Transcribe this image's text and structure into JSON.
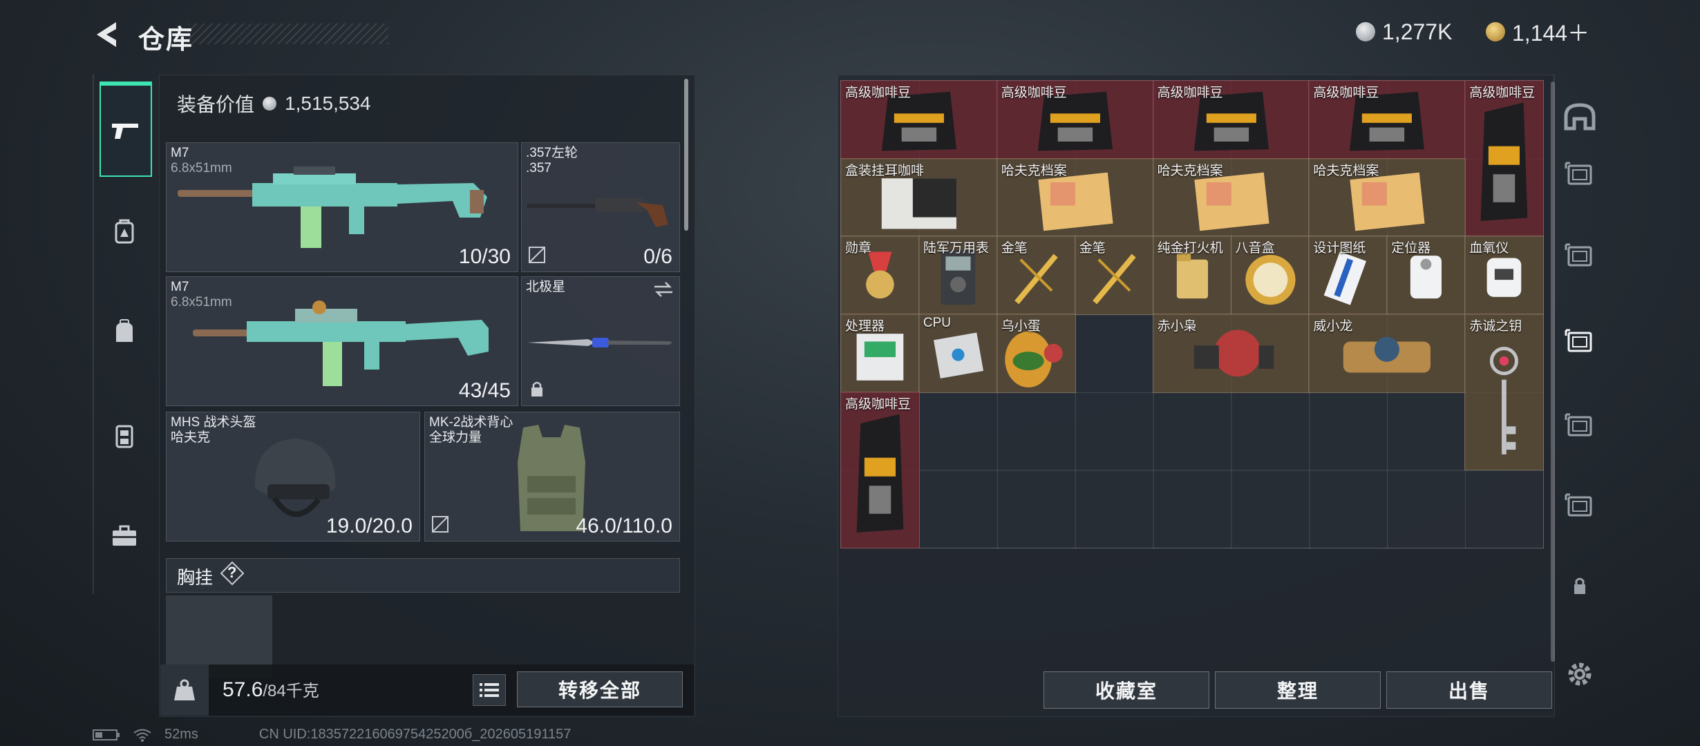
{
  "header": {
    "title": "仓库",
    "currency": [
      {
        "value": "1,277K",
        "icon": "silver-coin-icon",
        "color": "#c9ccd1"
      },
      {
        "value": "1,144＋",
        "icon": "gold-coin-icon",
        "color": "#d9b25a"
      }
    ]
  },
  "left_tabs": [
    "pistol-icon",
    "backpack-level-icon",
    "backpack-icon",
    "rig-icon",
    "briefcase-icon"
  ],
  "equipment": {
    "value_label": "装备价值",
    "value": "1,515,534",
    "primary_1": {
      "name": "M7",
      "caliber": "6.8x51mm",
      "ammo": "10/30"
    },
    "revolver": {
      "name": ".357左轮",
      "caliber": ".357",
      "ammo": "0/6"
    },
    "primary_2": {
      "name": "M7",
      "caliber": "6.8x51mm",
      "ammo": "43/45"
    },
    "knife": {
      "name": "北极星"
    },
    "helmet": {
      "name": "MHS 战术头盔",
      "brand": "哈夫克",
      "durability": "19.0/20.0"
    },
    "armor": {
      "name": "MK-2战术背心",
      "brand": "全球力量",
      "durability": "46.0/110.0"
    },
    "chest_rig": {
      "label": "胸挂",
      "help": "?"
    }
  },
  "bottom": {
    "weight_value": "57.6",
    "weight_max": "/84千克",
    "transfer_all": "转移全部"
  },
  "stash_items": [
    {
      "label": "高级咖啡豆",
      "color": "red",
      "icon": "coffee-bag-icon"
    },
    {
      "label": "高级咖啡豆",
      "color": "red",
      "icon": "coffee-bag-icon"
    },
    {
      "label": "高级咖啡豆",
      "color": "red",
      "icon": "coffee-bag-icon"
    },
    {
      "label": "高级咖啡豆",
      "color": "red",
      "icon": "coffee-bag-icon"
    },
    {
      "label": "高级咖啡豆",
      "color": "red",
      "icon": "coffee-bag-icon"
    },
    {
      "label": "盒装挂耳咖啡",
      "color": "gold",
      "icon": "coffee-box-icon"
    },
    {
      "label": "哈夫克档案",
      "color": "gold",
      "icon": "file-folder-icon"
    },
    {
      "label": "哈夫克档案",
      "color": "gold",
      "icon": "file-folder-icon"
    },
    {
      "label": "哈夫克档案",
      "color": "gold",
      "icon": "file-folder-icon"
    },
    {
      "label": "勋章",
      "color": "gold",
      "icon": "medal-icon"
    },
    {
      "label": "陆军万用表",
      "color": "gold",
      "icon": "multimeter-icon"
    },
    {
      "label": "金笔",
      "color": "gold",
      "icon": "gold-pen-icon"
    },
    {
      "label": "金笔",
      "color": "gold",
      "icon": "gold-pen-icon"
    },
    {
      "label": "纯金打火机",
      "color": "gold",
      "icon": "lighter-icon"
    },
    {
      "label": "八音盒",
      "color": "gold",
      "icon": "music-box-icon"
    },
    {
      "label": "设计图纸",
      "color": "gold",
      "icon": "blueprint-icon"
    },
    {
      "label": "定位器",
      "color": "gold",
      "icon": "locator-icon"
    },
    {
      "label": "血氧仪",
      "color": "gold",
      "icon": "oximeter-icon"
    },
    {
      "label": "处理器",
      "color": "gold",
      "icon": "processor-icon"
    },
    {
      "label": "CPU",
      "color": "gold",
      "icon": "cpu-icon"
    },
    {
      "label": "乌小蛋",
      "color": "gold",
      "icon": "egg-figure-icon"
    },
    {
      "label": "赤小枭",
      "color": "gold",
      "icon": "red-figure-icon"
    },
    {
      "label": "威小龙",
      "color": "gold",
      "icon": "dragon-figure-icon"
    },
    {
      "label": "赤诚之钥",
      "color": "gold",
      "icon": "key-icon"
    },
    {
      "label": "高级咖啡豆",
      "color": "red",
      "icon": "coffee-bag-icon"
    }
  ],
  "stash_buttons": {
    "collection": "收藏室",
    "sort": "整理",
    "sell": "出售"
  },
  "right_tabs": [
    "dome-icon",
    "stash-II-icon",
    "stash-III-icon",
    "stash-IV-icon",
    "stash-V-icon",
    "stash-IV-b-icon",
    "lock-icon",
    "settings-icon"
  ],
  "status_bar": {
    "ping": "52ms",
    "uid": "CN UID:18357221606975425200б_202605191157"
  }
}
